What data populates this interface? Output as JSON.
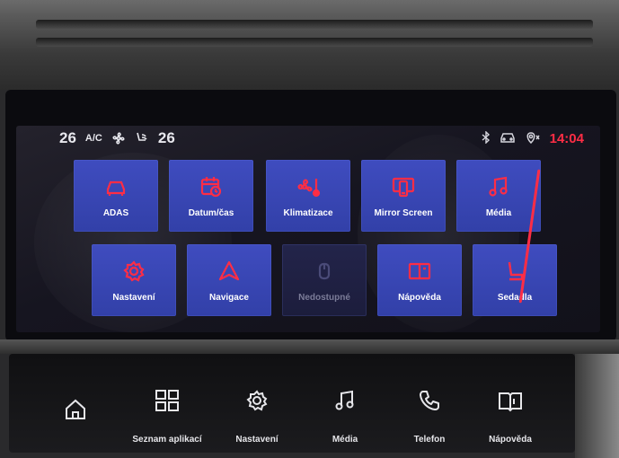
{
  "colors": {
    "accent": "#ff2d45",
    "tile": "#3a47b5",
    "screen_bg": "#16151e"
  },
  "status": {
    "left_temp": "26",
    "ac_label": "A/C",
    "fan_icon": "fan-icon",
    "seat_air_icon": "seat-airflow-icon",
    "right_temp": "26",
    "bluetooth_icon": "bluetooth-icon",
    "car_icon": "car-status-icon",
    "location_icon": "location-icon",
    "time": "14:04"
  },
  "apps": [
    {
      "label": "ADAS",
      "icon": "car-icon",
      "enabled": true
    },
    {
      "label": "Datum/čas",
      "icon": "calendar-clock-icon",
      "enabled": true
    },
    {
      "label": "Klimatizace",
      "icon": "fan-thermometer-icon",
      "enabled": true
    },
    {
      "label": "Mirror Screen",
      "icon": "mirror-screen-icon",
      "enabled": true
    },
    {
      "label": "Média",
      "icon": "music-note-icon",
      "enabled": true
    },
    {
      "label": "Nastavení",
      "icon": "gear-icon",
      "enabled": true
    },
    {
      "label": "Navigace",
      "icon": "navigation-arrow-icon",
      "enabled": true
    },
    {
      "label": "Nedostupné",
      "icon": "unavailable-icon",
      "enabled": false
    },
    {
      "label": "Nápověda",
      "icon": "book-icon",
      "enabled": true
    },
    {
      "label": "Sedadla",
      "icon": "seat-icon",
      "enabled": true
    }
  ],
  "panel": {
    "home_icon": "home-icon",
    "buttons": [
      {
        "label": "Seznam aplikací",
        "icon": "grid-icon"
      },
      {
        "label": "Nastavení",
        "icon": "gear-icon"
      },
      {
        "label": "Média",
        "icon": "music-note-icon"
      },
      {
        "label": "Telefon",
        "icon": "phone-icon"
      },
      {
        "label": "Nápověda",
        "icon": "book-icon"
      }
    ]
  }
}
